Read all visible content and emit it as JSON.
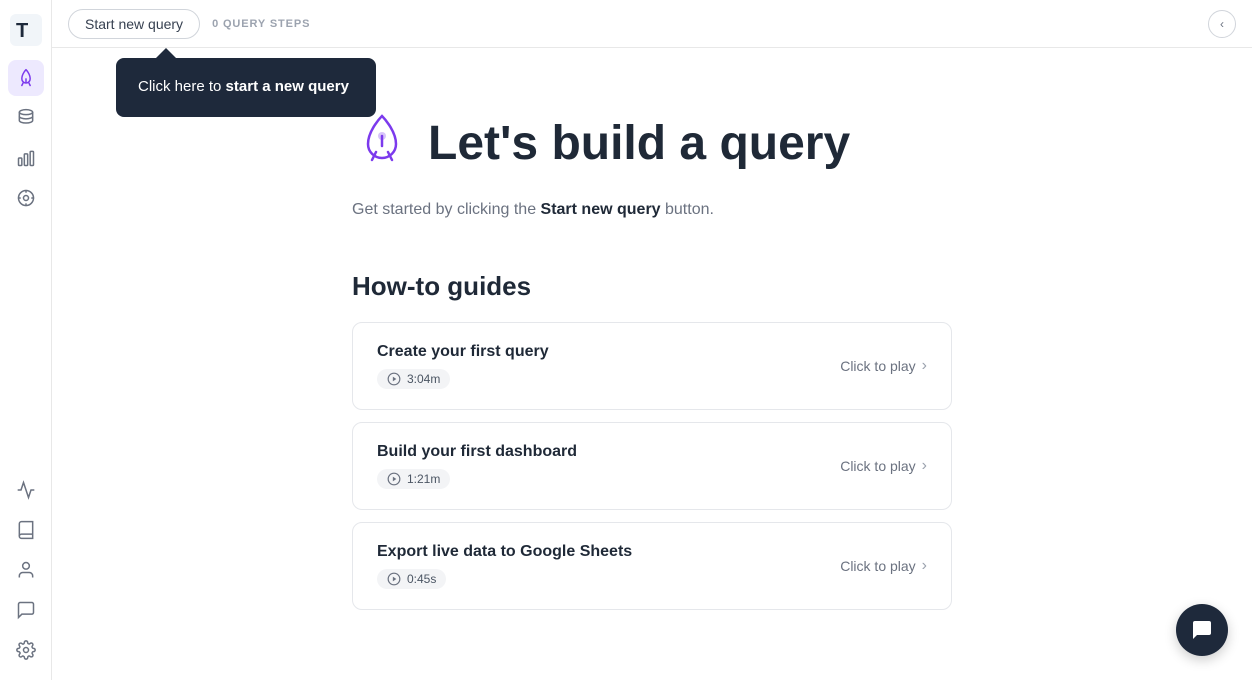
{
  "sidebar": {
    "logo_letter": "T",
    "items": [
      {
        "id": "query-builder",
        "label": "Query Builder",
        "active": true
      },
      {
        "id": "database",
        "label": "Database"
      },
      {
        "id": "charts",
        "label": "Charts"
      },
      {
        "id": "explore",
        "label": "Explore"
      }
    ],
    "bottom_items": [
      {
        "id": "activity",
        "label": "Activity"
      },
      {
        "id": "docs",
        "label": "Documentation"
      },
      {
        "id": "profile",
        "label": "Profile"
      },
      {
        "id": "feedback",
        "label": "Feedback"
      },
      {
        "id": "settings",
        "label": "Settings"
      }
    ]
  },
  "topbar": {
    "start_query_label": "Start new query",
    "query_steps_label": "0 QUERY STEPS"
  },
  "tooltip": {
    "text_prefix": "Click here to ",
    "text_bold": "start a new query"
  },
  "hero": {
    "title": "Let's build a query",
    "subtitle_prefix": "Get started by clicking the ",
    "subtitle_bold": "Start new query",
    "subtitle_suffix": " button."
  },
  "guides": {
    "section_title": "How-to guides",
    "items": [
      {
        "title": "Create your first query",
        "duration": "3:04m",
        "play_label": "Click to play"
      },
      {
        "title": "Build your first dashboard",
        "duration": "1:21m",
        "play_label": "Click to play"
      },
      {
        "title": "Export live data to Google Sheets",
        "duration": "0:45s",
        "play_label": "Click to play"
      }
    ]
  },
  "chat": {
    "label": "Chat"
  }
}
